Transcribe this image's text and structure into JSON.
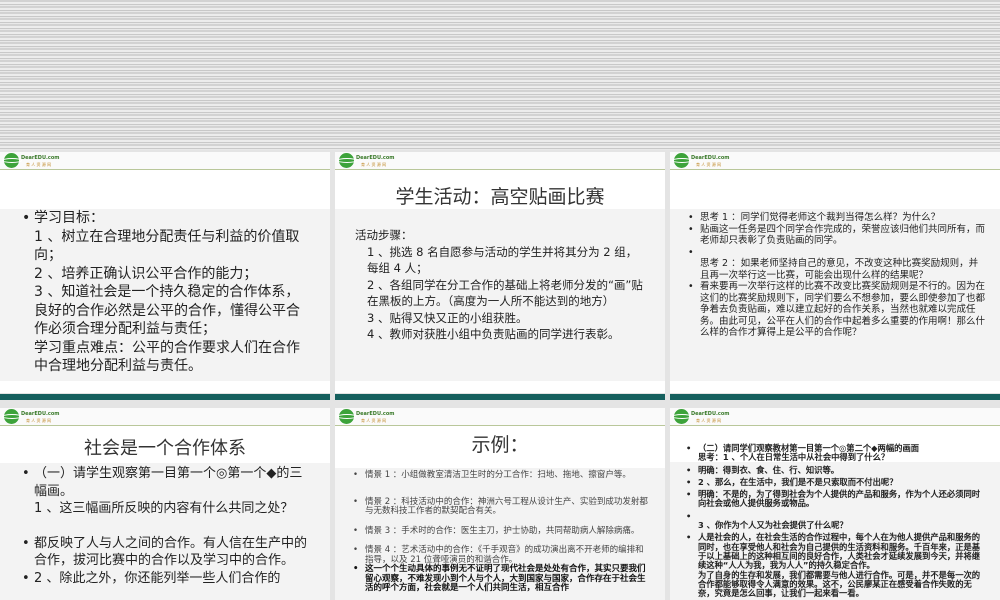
{
  "logo": {
    "text": "DearEDU.com",
    "sub": "育 人 资 源 网"
  },
  "slides": [
    {
      "title": "",
      "items": [
        "学习目标：",
        "1 、树立在合理地分配责任与利益的价值取向；",
        "2 、培养正确认识公平合作的能力；",
        "3 、知道社会是一个持久稳定的合作体系，良好的合作必然是公平的合作，懂得公平合作必须合理分配利益与责任；",
        "学习重点难点：公平的合作要求人们在合作中合理地分配利益与责任。"
      ]
    },
    {
      "title": "学生活动：高空贴画比赛",
      "heading": "活动步骤：",
      "items": [
        "1 、挑选 8 名自愿参与活动的学生并将其分为 2 组，每组 4 人；",
        "2 、各组同学在分工合作的基础上将老师分发的“画”贴在黑板的上方。（高度为一人所不能达到的地方）",
        "3 、贴得又快又正的小组获胜。",
        "4 、教师对获胜小组中负责贴画的同学进行表彰。"
      ]
    },
    {
      "title": "",
      "items": [
        "思考 1 ：同学们觉得老师这个裁判当得怎么样？为什么？",
        "贴画这一任务是四个同学合作完成的，荣誉应该归他们共同所有，而老师却只表彰了负责贴画的同学。",
        "思考 2 ：如果老师坚持自己的意见，不改变这种比赛奖励规则，并且再一次举行这一比赛，可能会出现什么样的结果呢？",
        "看来要再一次举行这样的比赛不改变比赛奖励规则是不行的。因为在这们的比赛奖励规则下，同学们要么不想参加，要么即使参加了也都争着去负责贴画，难以建立起好的合作关系，当然也就难以完成任务。由此可见，公平在人们的合作中起着多么重要的作用啊！那么什么样的合作才算得上是公平的合作呢？"
      ]
    },
    {
      "title": "社会是一个合作体系",
      "items": [
        "（一）请学生观察第一目第一个◎第一个◆的三幅画。\n1 、这三幅画所反映的内容有什么共同之处？",
        "都反映了人与人之间的合作。有人信在生产中的合作，拔河比赛中的合作以及学习中的合作。",
        "2 、除此之外，你还能列举一些人们合作的"
      ]
    },
    {
      "title": "示例：",
      "items": [
        "情景 1 ：小组做教室清洁卫生时的分工合作：扫地、拖地、擦窗户等。",
        "情景 2 ：科技活动中的合作：神洲六号工程从设计生产、实验到成功发射都与无数科技工作者的默契配合有关。",
        "情景 3 ：手术时的合作：医生主刀，护士协助，共同帮助病人解除病痛。",
        "情景 4 ：艺术活动中的合作：《千手观音》的成功演出离不开老师的编排和指导，以及 21 位聋哑演员的和谐合作。",
        "这一个个生动具体的事例无不证明了现代社会是处处有合作，其实只要我们留心观察，不难发现小到个人与个人，大到国家与国家，合作存在于社会生活的呼个方面，社会就是一个人们共同生活，相互合作"
      ]
    },
    {
      "title": "",
      "items": [
        "（二）请同学们观察教材第一目第一个◎第二个◆两幅的画面\n思考：1 、个人在日常生活中从社会中得到了什么？",
        "明确：得到衣、食、住、行、知识等。",
        "2 、那么，在生活中，我们是不是只索取而不付出呢？",
        "明确：不是的，为了得到社会为个人提供的产品和服务，作为个人还必须同时向社会或他人提供服务或物品。",
        "3 、你作为个人又为社会提供了什么呢？",
        "人是社会的人，在社会生活的合作过程中，每个人在为他人提供产品和服务的同时，也在享受他人和社会为自己提供的生活资料和服务。千百年来，正是基于以上基础上的这种相互间的良好合作，人类社会才延续发展到今天，并将继续这种“人人为我，我为人人”的持久稳定合作。\n为了自身的生存和发展，我们都需要与他人进行合作。可是，并不是每一次的合作都能够取得令人满意的效果。这不，公民廖某正在感受着合作失败的无奈，究竟是怎么回事，让我们一起来看一看。"
      ]
    }
  ]
}
